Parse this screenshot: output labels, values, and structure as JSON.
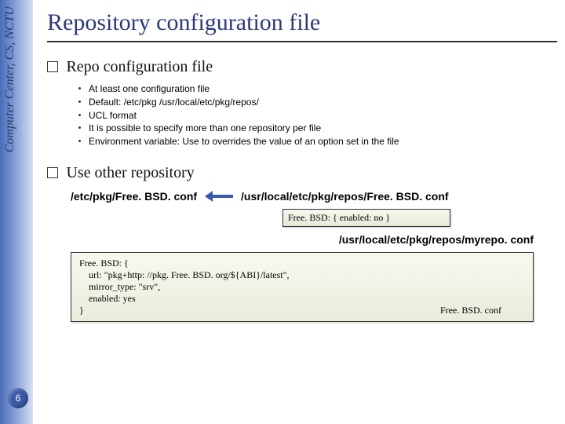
{
  "sidebar": {
    "text": "Computer Center, CS, NCTU"
  },
  "page_number": "6",
  "title": "Repository configuration file",
  "sections": [
    {
      "heading": "Repo configuration file",
      "items": [
        "At least one configuration file",
        "Default:  /etc/pkg  /usr/local/etc/pkg/repos/",
        "UCL format",
        "It is possible to specify more than one repository per file",
        "Environment variable: Use to overrides the value of an option set in the file"
      ]
    },
    {
      "heading": "Use other repository"
    }
  ],
  "path_left": "/etc/pkg/Free. BSD. conf",
  "path_right": "/usr/local/etc/pkg/repos/Free. BSD. conf",
  "code_small": "Free. BSD: { enabled: no }",
  "path_right2": "/usr/local/etc/pkg/repos/myrepo. conf",
  "code_big": {
    "l1": "Free. BSD: {",
    "l2": "    url: \"pkg+http: //pkg. Free. BSD. org/${ABI}/latest\",",
    "l3": "    mirror_type: \"srv\",",
    "l4": "    enabled: yes",
    "l5": "}",
    "ref": "Free. BSD. conf"
  }
}
